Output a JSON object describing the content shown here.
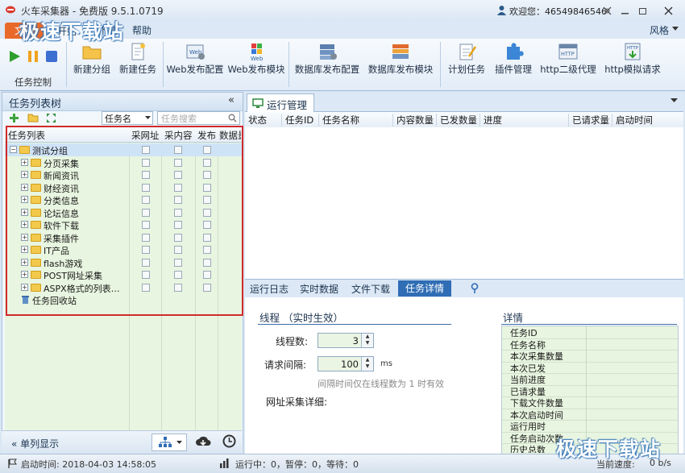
{
  "app": {
    "title": "火车采集器 - 免费版 9.5.1.0719",
    "welcome": "欢迎您：46549846546",
    "skin": "风格"
  },
  "menu": {
    "file": "文件",
    "start": "开始",
    "download": "下载",
    "help": "帮助"
  },
  "ribbon": {
    "group_label": "任务控制",
    "new_group": "新建分组",
    "new_task": "新建任务",
    "web_publish_config": "Web发布配置",
    "web_publish_module": "Web发布模块",
    "db_publish_config": "数据库发布配置",
    "db_publish_module": "数据库发布模块",
    "schedule": "计划任务",
    "plugins": "插件管理",
    "http_proxy": "http二级代理",
    "http_simulate": "http模拟请求"
  },
  "left_panel": {
    "title": "任务列表树",
    "field_select": "任务名",
    "search_placeholder": "任务搜索",
    "columns": [
      "任务列表",
      "采网址",
      "采内容",
      "发布",
      "数据量"
    ],
    "root": "测试分组",
    "items": [
      "分页采集",
      "新闻资讯",
      "财经资讯",
      "分类信息",
      "论坛信息",
      "软件下载",
      "采集插件",
      "IT产品",
      "flash游戏",
      "POST网址采集",
      "ASPX格式的列表…"
    ],
    "recycle": "任务回收站",
    "single_column": "单列显示"
  },
  "run_panel": {
    "tab": "运行管理",
    "columns": [
      "状态",
      "任务ID",
      "任务名称",
      "内容数量",
      "已发数量",
      "进度",
      "已请求量",
      "启动时间"
    ]
  },
  "bottom_panel": {
    "tabs": [
      "运行日志",
      "实时数据",
      "文件下载",
      "任务详情"
    ],
    "thread_title": "线程 （实时生效）",
    "thread_count_label": "线程数:",
    "thread_count": "3",
    "interval_label": "请求间隔:",
    "interval": "100",
    "interval_unit": "ms",
    "hint": "间隔时间仅在线程数为 1 时有效",
    "url_detail_label": "网址采集详细:",
    "detail_title": "详情",
    "detail_rows": [
      "任务ID",
      "任务名称",
      "本次采集数量",
      "本次已发",
      "当前进度",
      "已请求量",
      "下载文件数量",
      "本次启动时间",
      "运行用时",
      "任务启动次数",
      "历史总数"
    ]
  },
  "status": {
    "start_time": "启动时间: 2018-04-03 14:58:05",
    "counts": "运行中：0，暂停：0，等待：0",
    "speed_label": "当前速度:",
    "speed_value": "0 b/s"
  },
  "watermark": "极速下载站",
  "colors": {
    "highlight_box": "#d12a2a",
    "grid_green": "#e8f5e0",
    "active_tab": "#2f6db5",
    "file_tab": "#e8692a"
  }
}
